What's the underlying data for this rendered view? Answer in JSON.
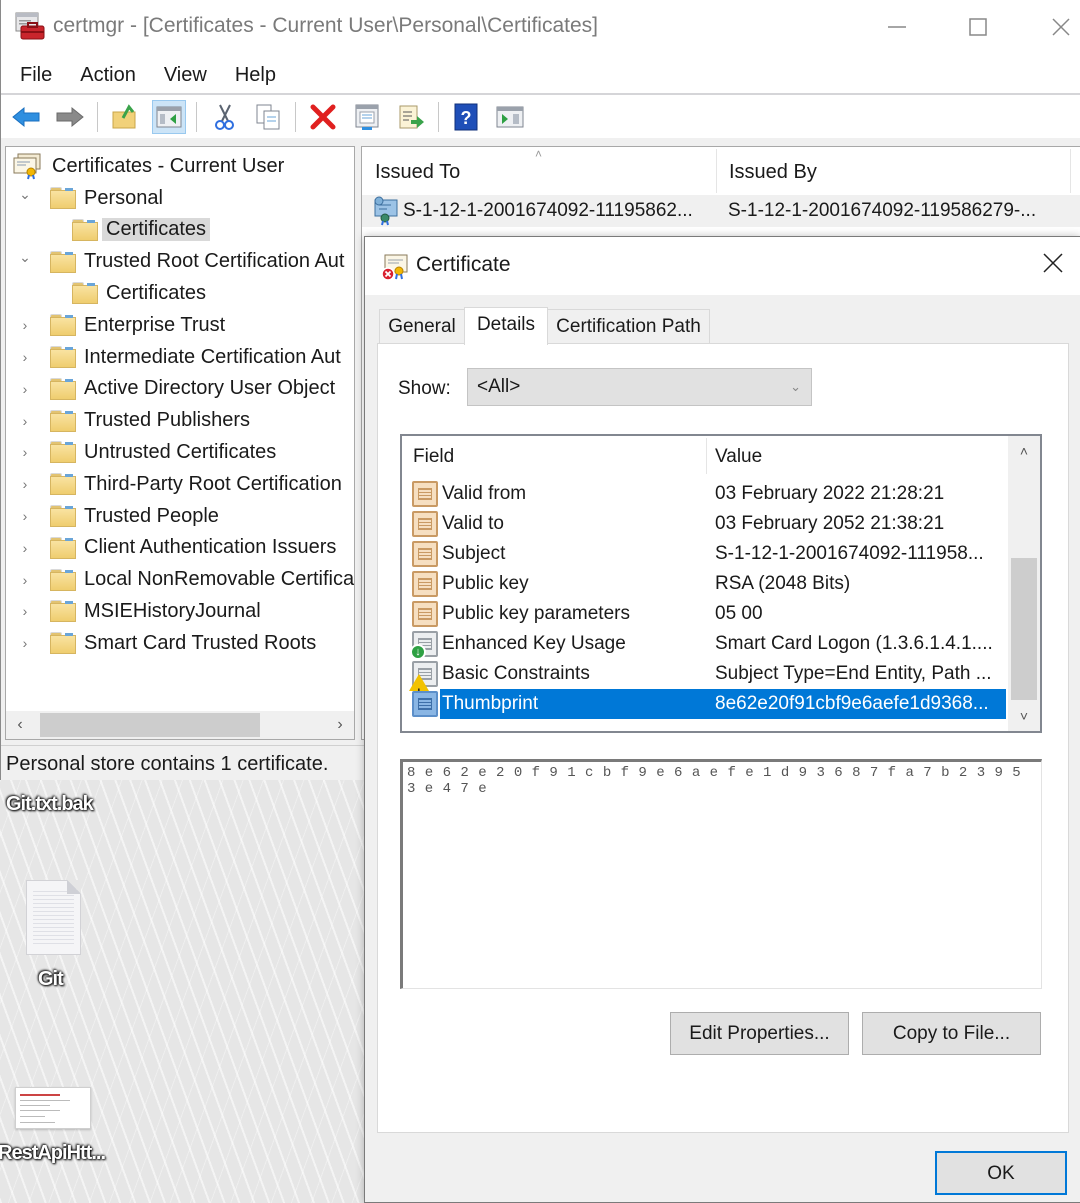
{
  "main_window": {
    "title": "certmgr - [Certificates - Current User\\Personal\\Certificates]",
    "controls": {
      "minimize": "—",
      "maximize": "☐",
      "close": "✕"
    },
    "menu": [
      "File",
      "Action",
      "View",
      "Help"
    ],
    "toolbar": [
      {
        "icon": "back-arrow-icon",
        "label": "Back"
      },
      {
        "icon": "forward-arrow-icon",
        "label": "Forward"
      },
      {
        "icon": "up-folder-icon",
        "label": "Up One Level"
      },
      {
        "icon": "show-hide-console-tree-icon",
        "label": "Show/Hide Console Tree",
        "active": true
      },
      {
        "icon": "cut-icon",
        "label": "Cut"
      },
      {
        "icon": "copy-icon",
        "label": "Copy"
      },
      {
        "icon": "delete-icon",
        "label": "Delete"
      },
      {
        "icon": "properties-icon",
        "label": "Properties"
      },
      {
        "icon": "export-list-icon",
        "label": "Export List"
      },
      {
        "icon": "help-icon",
        "label": "Help"
      },
      {
        "icon": "show-hide-action-pane-icon",
        "label": "Show/Hide Action Pane"
      }
    ],
    "tree": {
      "root": "Certificates - Current User",
      "items": [
        {
          "label": "Personal",
          "level": 1,
          "expander": "expanded"
        },
        {
          "label": "Certificates",
          "level": 2,
          "expander": "none",
          "selected": true
        },
        {
          "label": "Trusted Root Certification Aut",
          "level": 1,
          "expander": "expanded"
        },
        {
          "label": "Certificates",
          "level": 2,
          "expander": "none"
        },
        {
          "label": "Enterprise Trust",
          "level": 1,
          "expander": "collapsed"
        },
        {
          "label": "Intermediate Certification Aut",
          "level": 1,
          "expander": "collapsed"
        },
        {
          "label": "Active Directory User Object",
          "level": 1,
          "expander": "collapsed"
        },
        {
          "label": "Trusted Publishers",
          "level": 1,
          "expander": "collapsed"
        },
        {
          "label": "Untrusted Certificates",
          "level": 1,
          "expander": "collapsed"
        },
        {
          "label": "Third-Party Root Certification",
          "level": 1,
          "expander": "collapsed"
        },
        {
          "label": "Trusted People",
          "level": 1,
          "expander": "collapsed"
        },
        {
          "label": "Client Authentication Issuers",
          "level": 1,
          "expander": "collapsed"
        },
        {
          "label": "Local NonRemovable Certifica",
          "level": 1,
          "expander": "collapsed"
        },
        {
          "label": "MSIEHistoryJournal",
          "level": 1,
          "expander": "collapsed"
        },
        {
          "label": "Smart Card Trusted Roots",
          "level": 1,
          "expander": "collapsed"
        }
      ]
    },
    "list": {
      "columns": [
        "Issued To",
        "Issued By"
      ],
      "rows": [
        {
          "issued_to": "S-1-12-1-2001674092-11195862...",
          "issued_by": "S-1-12-1-2001674092-119586279-..."
        }
      ]
    },
    "status": "Personal store contains 1 certificate."
  },
  "desktop": {
    "icons": [
      {
        "label": "Git.txt.bak"
      },
      {
        "label": "Git"
      },
      {
        "label": "RestApiHtt..."
      }
    ]
  },
  "dialog": {
    "title": "Certificate",
    "close": "✕",
    "tabs": [
      {
        "label": "General",
        "active": false
      },
      {
        "label": "Details",
        "active": true
      },
      {
        "label": "Certification Path",
        "active": false
      }
    ],
    "show_label": "Show:",
    "show_value": "<All>",
    "field_list": {
      "columns": [
        "Field",
        "Value"
      ],
      "rows": [
        {
          "field": "Valid from",
          "value": "03 February 2022 21:28:21",
          "icon": "property"
        },
        {
          "field": "Valid to",
          "value": "03 February 2052 21:38:21",
          "icon": "property"
        },
        {
          "field": "Subject",
          "value": "S-1-12-1-2001674092-111958...",
          "icon": "property"
        },
        {
          "field": "Public key",
          "value": "RSA (2048 Bits)",
          "icon": "property"
        },
        {
          "field": "Public key parameters",
          "value": "05 00",
          "icon": "property"
        },
        {
          "field": "Enhanced Key Usage",
          "value": "Smart Card Logon (1.3.6.1.4.1....",
          "icon": "extension"
        },
        {
          "field": "Basic Constraints",
          "value": "Subject Type=End Entity, Path ...",
          "icon": "critical-extension"
        },
        {
          "field": "Thumbprint",
          "value": "8e62e20f91cbf9e6aefe1d9368...",
          "icon": "property",
          "selected": true
        }
      ]
    },
    "detail_value": "8e62e20f91cbf9e6aefe1d93687fa7b23953e47e",
    "buttons": {
      "edit_properties": "Edit Properties...",
      "copy_to_file": "Copy to File...",
      "ok": "OK"
    }
  }
}
